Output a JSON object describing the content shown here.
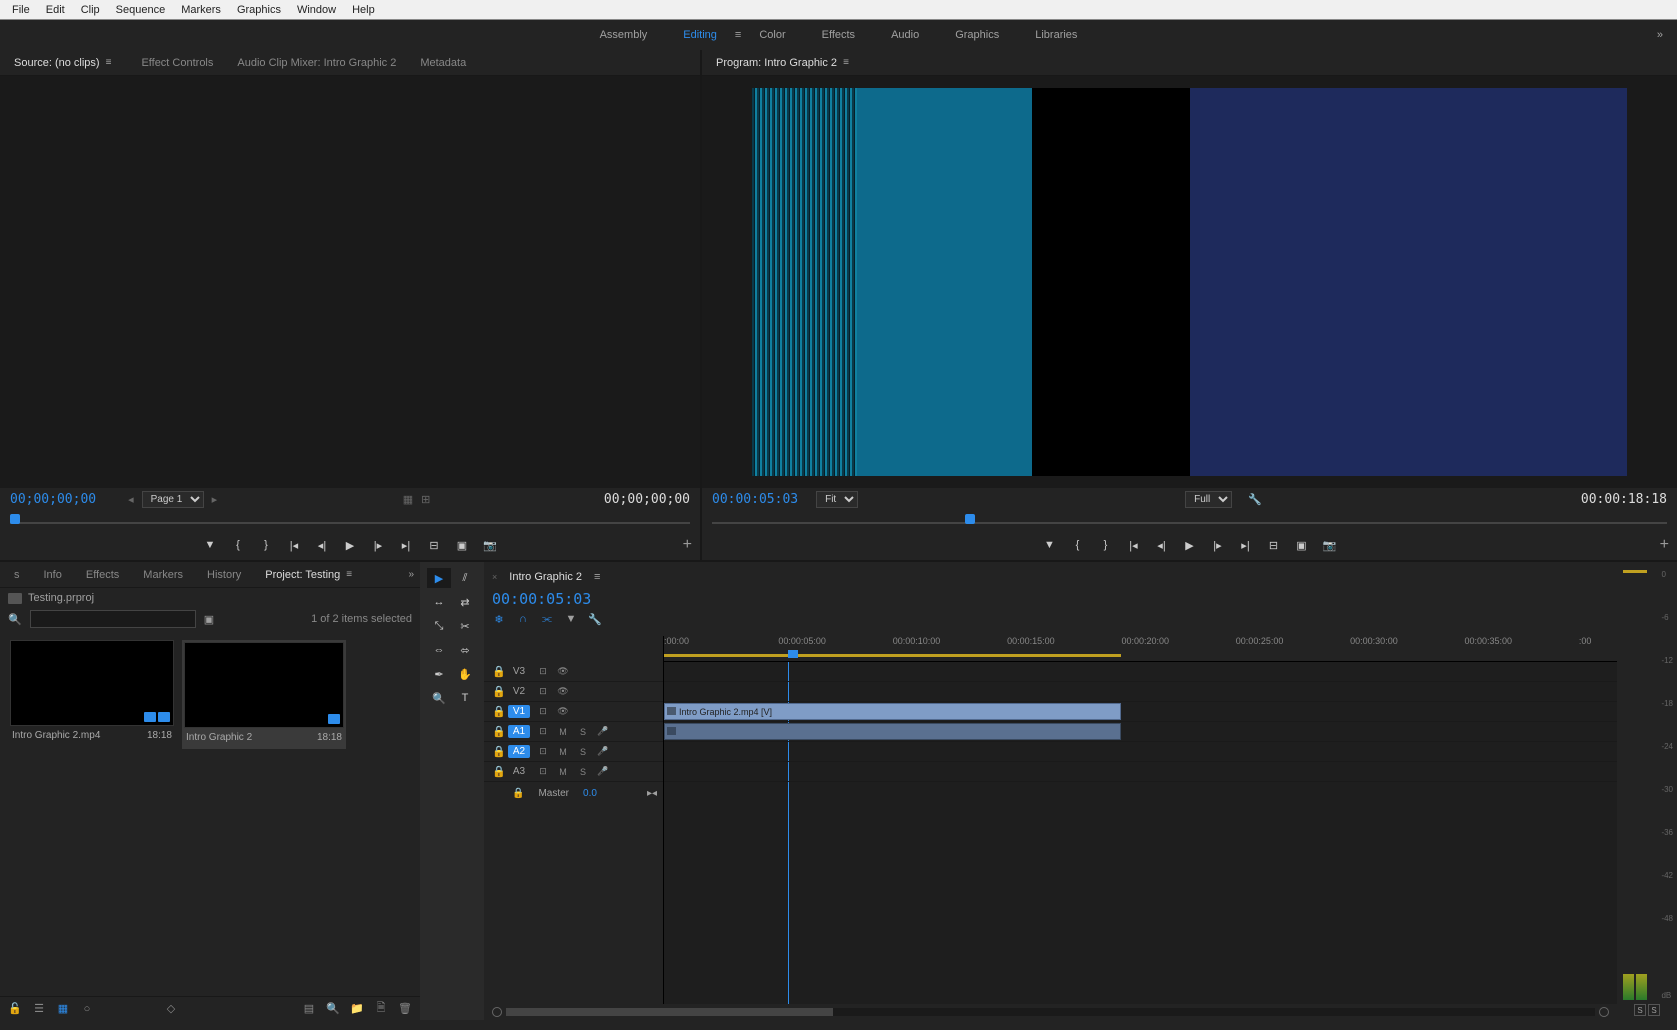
{
  "menubar": [
    "File",
    "Edit",
    "Clip",
    "Sequence",
    "Markers",
    "Graphics",
    "Window",
    "Help"
  ],
  "workspaces": {
    "items": [
      "Assembly",
      "Editing",
      "Color",
      "Effects",
      "Audio",
      "Graphics",
      "Libraries"
    ],
    "active": "Editing",
    "more": "»"
  },
  "source_panel": {
    "tabs": [
      "Source: (no clips)",
      "Effect Controls",
      "Audio Clip Mixer: Intro Graphic 2",
      "Metadata"
    ],
    "active_tab": "Source: (no clips)",
    "tc_left": "00;00;00;00",
    "page_label": "Page 1",
    "tc_right": "00;00;00;00"
  },
  "program_panel": {
    "tab": "Program: Intro Graphic 2",
    "tc_left": "00:00:05:03",
    "fit_label": "Fit",
    "quality_label": "Full",
    "tc_right": "00:00:18:18",
    "playhead_pct": 27
  },
  "lower_tabs": {
    "tabs": [
      "s",
      "Info",
      "Effects",
      "Markers",
      "History",
      "Project: Testing"
    ],
    "active": "Project: Testing"
  },
  "project": {
    "breadcrumb": "Testing.prproj",
    "search_placeholder": "",
    "selection_text": "1 of 2 items selected",
    "items": [
      {
        "name": "Intro Graphic 2.mp4",
        "duration": "18:18",
        "selected": false,
        "badges": 2
      },
      {
        "name": "Intro Graphic 2",
        "duration": "18:18",
        "selected": true,
        "badges": 1
      }
    ]
  },
  "tools": {
    "grid": [
      [
        "selection",
        "track-select"
      ],
      [
        "ripple",
        "rolling"
      ],
      [
        "rate-stretch",
        "razor"
      ],
      [
        "slip",
        "slide"
      ],
      [
        "pen",
        "hand"
      ],
      [
        "zoom",
        "type"
      ]
    ],
    "active": "selection",
    "glyphs": {
      "selection": "▶",
      "track-select": "⫽",
      "ripple": "↔",
      "rolling": "⇄",
      "rate-stretch": "⤡",
      "razor": "✂",
      "slip": "⇔",
      "slide": "⬄",
      "pen": "✒",
      "hand": "✋",
      "zoom": "🔍",
      "type": "T"
    }
  },
  "timeline": {
    "sequence_name": "Intro Graphic 2",
    "tc": "00:00:05:03",
    "ruler_ticks": [
      ":00:00",
      "00:00:05:00",
      "00:00:10:00",
      "00:00:15:00",
      "00:00:20:00",
      "00:00:25:00",
      "00:00:30:00",
      "00:00:35:00",
      ":00"
    ],
    "playhead_pct": 13,
    "video_tracks": [
      "V3",
      "V2",
      "V1"
    ],
    "audio_tracks": [
      "A1",
      "A2",
      "A3"
    ],
    "highlighted": [
      "V1",
      "A1",
      "A2"
    ],
    "clip_name": "Intro Graphic 2.mp4 [V]",
    "master_label": "Master",
    "master_value": "0.0"
  },
  "meters": {
    "scale": [
      "0",
      "-6",
      "-12",
      "-18",
      "-24",
      "-30",
      "-36",
      "-42",
      "-48",
      "",
      "dB"
    ],
    "solo": [
      "S",
      "S"
    ]
  },
  "transport_icons": [
    "marker",
    "in",
    "out",
    "goto-in",
    "step-back",
    "play",
    "step-fwd",
    "goto-out",
    "lift",
    "extract",
    "camera"
  ]
}
